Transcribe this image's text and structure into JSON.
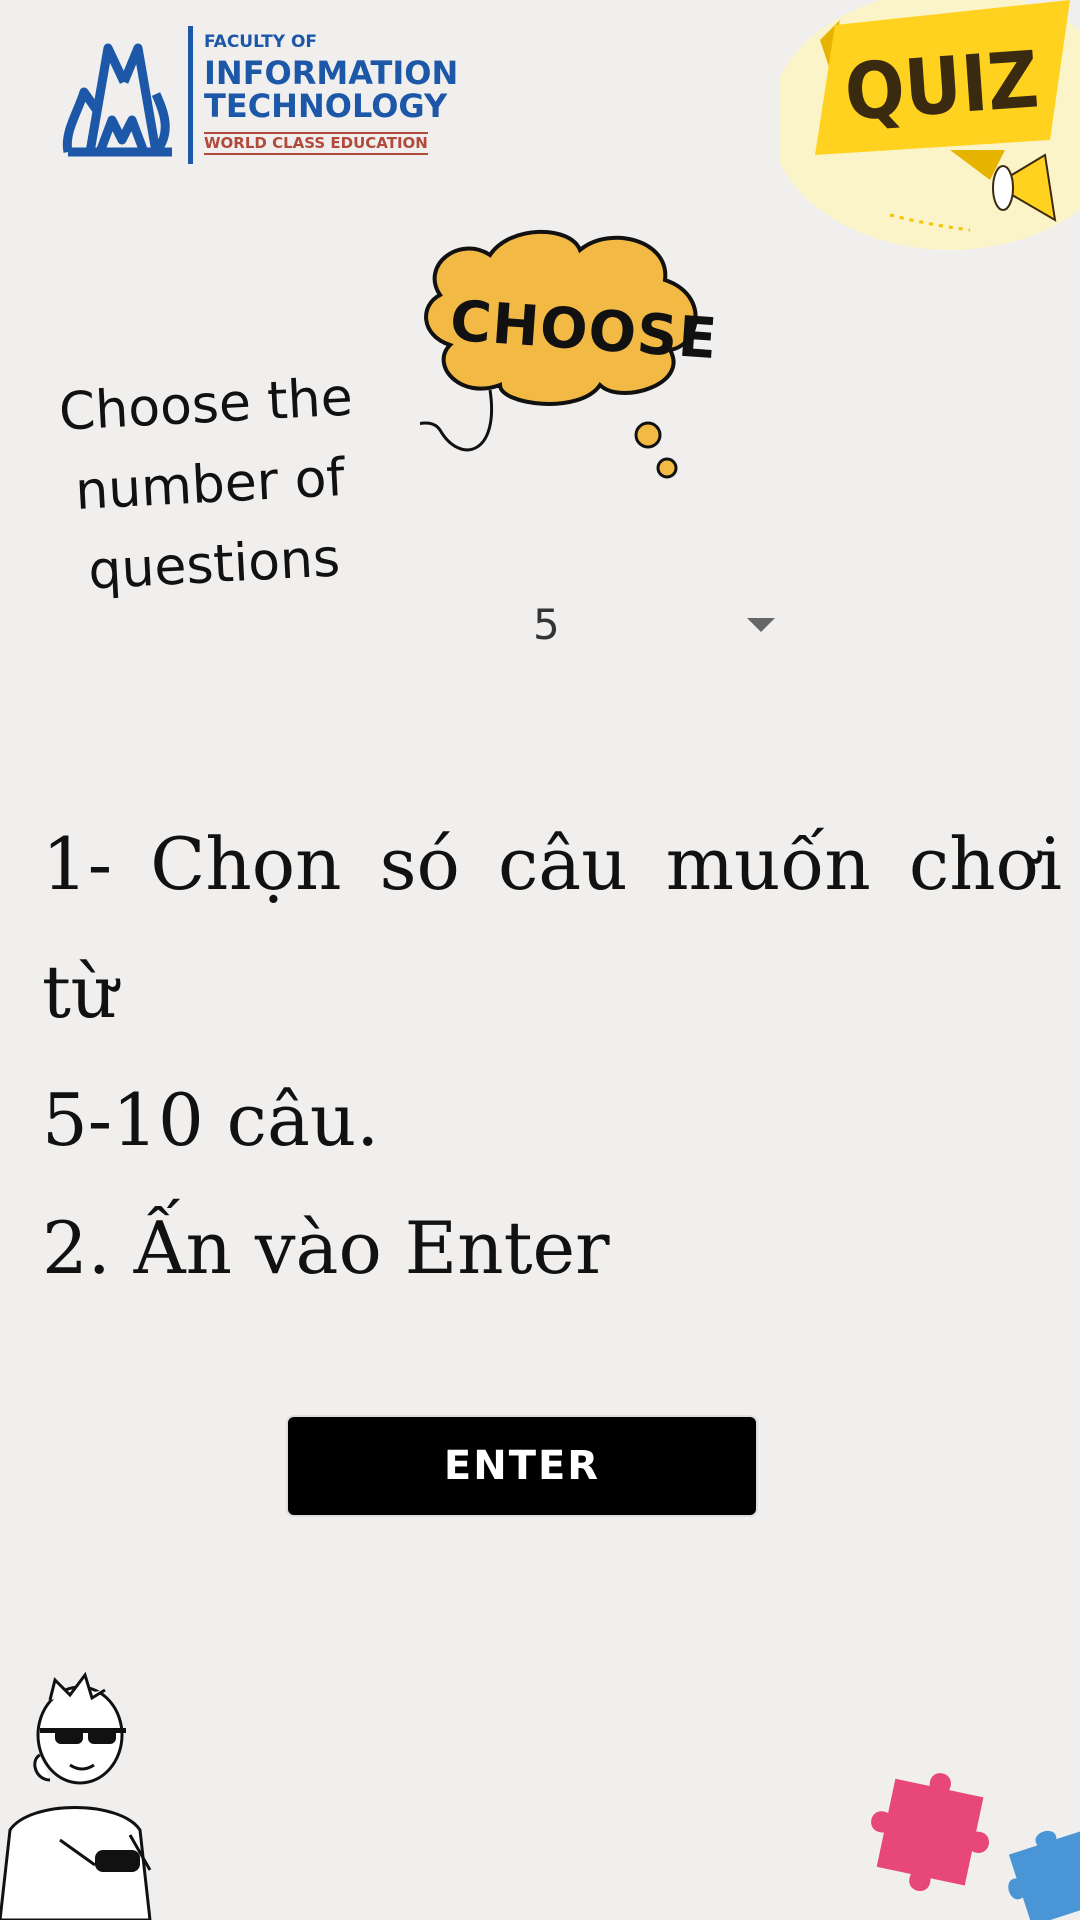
{
  "logo": {
    "line1": "FACULTY OF",
    "line2": "INFORMATION",
    "line3": "TECHNOLOGY",
    "tagline": "WORLD CLASS EDUCATION",
    "brand_color": "#1c57a8",
    "tagline_color": "#b24a3c"
  },
  "banner": {
    "label": "QUIZ",
    "color": "#ffd21f"
  },
  "hint": {
    "text_lines": [
      "Choose the",
      "number of",
      "questions"
    ]
  },
  "cloud": {
    "label": "CHOOSE",
    "color": "#f2b944"
  },
  "question_count_select": {
    "selected": "5",
    "options": [
      "5"
    ]
  },
  "instructions": {
    "line1": "1- Chọn só câu muốn chơi từ",
    "line2": "5-10 câu.",
    "line3": "2. Ấn vào Enter"
  },
  "enter_button": {
    "label": "ENTER"
  },
  "icons": {
    "character": "gamer-character-icon",
    "puzzle": "puzzle-pieces-icon",
    "megaphone": "megaphone-icon"
  }
}
